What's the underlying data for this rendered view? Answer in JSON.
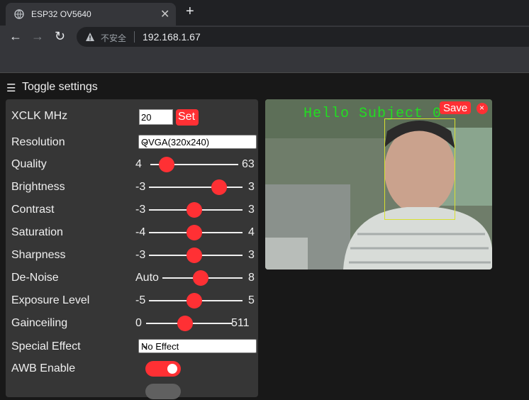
{
  "browser": {
    "tab_title": "ESP32 OV5640",
    "tab_close": "✕",
    "new_tab": "+",
    "back": "←",
    "forward": "→",
    "reload": "↻",
    "security_label": "不安全",
    "url": "192.168.1.67"
  },
  "page": {
    "menu_icon": "☰",
    "toggle_settings": "Toggle settings"
  },
  "settings": {
    "xclk": {
      "label": "XCLK MHz",
      "value": "20",
      "button": "Set"
    },
    "resolution": {
      "label": "Resolution",
      "selected": "QVGA(320x240)"
    },
    "quality": {
      "label": "Quality",
      "min": "4",
      "max": "63",
      "value": 10
    },
    "brightness": {
      "label": "Brightness",
      "min": "-3",
      "max": "3",
      "value": 2
    },
    "contrast": {
      "label": "Contrast",
      "min": "-3",
      "max": "3",
      "value": 0
    },
    "saturation": {
      "label": "Saturation",
      "min": "-4",
      "max": "4",
      "value": 0
    },
    "sharpness": {
      "label": "Sharpness",
      "min": "-3",
      "max": "3",
      "value": 0
    },
    "denoise": {
      "label": "De-Noise",
      "min": "Auto",
      "max": "8",
      "value": 4
    },
    "exposure": {
      "label": "Exposure Level",
      "min": "-5",
      "max": "5",
      "value": 0
    },
    "gainceiling": {
      "label": "Gainceiling",
      "min": "0",
      "max": "511",
      "value": 250
    },
    "special_effect": {
      "label": "Special Effect",
      "selected": "No Effect"
    },
    "awb": {
      "label": "AWB Enable",
      "on": true
    }
  },
  "stream": {
    "overlay_text": "Hello Subject 0",
    "save": "Save",
    "close": "×"
  },
  "colors": {
    "accent": "#ff3034",
    "panel": "#363636",
    "background": "#181818",
    "overlay": "#22dd22"
  }
}
